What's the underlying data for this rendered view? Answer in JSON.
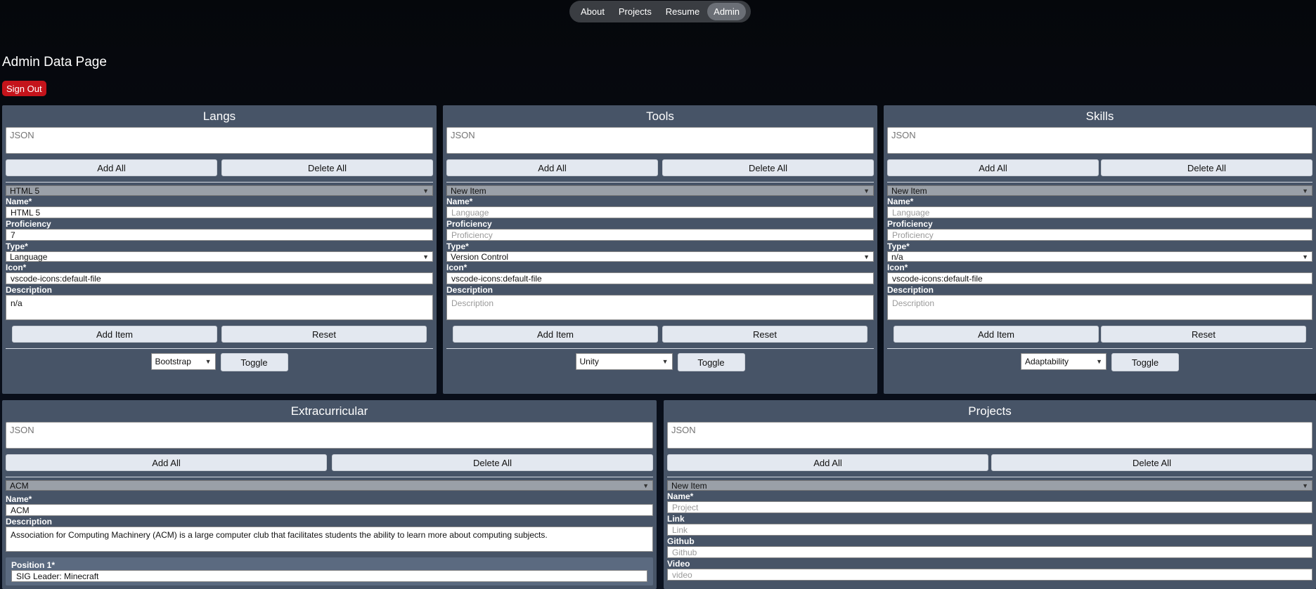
{
  "nav": {
    "items": [
      "About",
      "Projects",
      "Resume",
      "Admin"
    ],
    "active": "Admin"
  },
  "page": {
    "title": "Admin Data Page",
    "sign_out": "Sign Out"
  },
  "common": {
    "json_placeholder": "JSON",
    "add_all": "Add All",
    "delete_all": "Delete All",
    "add_item": "Add Item",
    "reset": "Reset",
    "toggle": "Toggle"
  },
  "langs": {
    "title": "Langs",
    "selected_item": "HTML 5",
    "labels": {
      "name": "Name*",
      "proficiency": "Proficiency",
      "type": "Type*",
      "icon": "Icon*",
      "description": "Description"
    },
    "values": {
      "name": "HTML 5",
      "proficiency": "7",
      "type": "Language",
      "icon": "vscode-icons:default-file",
      "description": "n/a"
    },
    "toggle_select": "Bootstrap"
  },
  "tools": {
    "title": "Tools",
    "selected_item": "New Item",
    "labels": {
      "name": "Name*",
      "proficiency": "Proficiency",
      "type": "Type*",
      "icon": "Icon*",
      "description": "Description"
    },
    "placeholders": {
      "name": "Language",
      "proficiency": "Proficiency",
      "description": "Description"
    },
    "values": {
      "type": "Version Control",
      "icon": "vscode-icons:default-file"
    },
    "toggle_select": "Unity"
  },
  "skills": {
    "title": "Skills",
    "selected_item": "New Item",
    "labels": {
      "name": "Name*",
      "proficiency": "Proficiency",
      "type": "Type*",
      "icon": "Icon*",
      "description": "Description"
    },
    "placeholders": {
      "name": "Language",
      "proficiency": "Proficiency",
      "description": "Description"
    },
    "values": {
      "type": "n/a",
      "icon": "vscode-icons:default-file"
    },
    "toggle_select": "Adaptability"
  },
  "extracurricular": {
    "title": "Extracurricular",
    "selected_item": "ACM",
    "labels": {
      "name": "Name*",
      "description": "Description",
      "position": "Position 1*"
    },
    "values": {
      "name": "ACM",
      "description": "Association for Computing Machinery (ACM) is a large computer club that facilitates students the ability to learn more about computing subjects.",
      "position": "SIG Leader: Minecraft"
    }
  },
  "projects": {
    "title": "Projects",
    "selected_item": "New Item",
    "labels": {
      "name": "Name*",
      "link": "Link",
      "github": "Github",
      "video": "Video"
    },
    "placeholders": {
      "name": "Project",
      "link": "Link",
      "github": "Github",
      "video": "video"
    }
  }
}
